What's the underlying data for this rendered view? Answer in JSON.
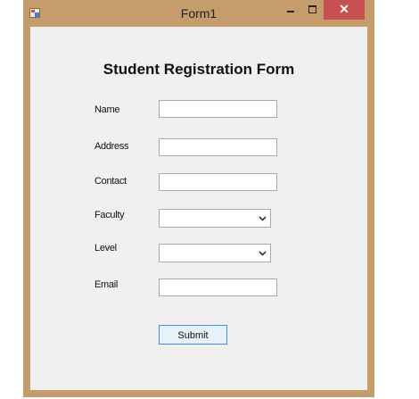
{
  "window": {
    "title": "Form1",
    "close_glyph": "✕",
    "icons": {
      "app": "form-app-icon",
      "minimize": "minimize-icon",
      "maximize": "maximize-icon",
      "close": "close-icon"
    },
    "colors": {
      "frame": "#c59c6c",
      "close_button": "#c75050",
      "client": "#f0f0f0",
      "submit_border": "#4a90d9"
    }
  },
  "form": {
    "heading": "Student Registration Form",
    "fields": {
      "name": {
        "label": "Name",
        "value": ""
      },
      "address": {
        "label": "Address",
        "value": ""
      },
      "contact": {
        "label": "Contact",
        "value": ""
      },
      "faculty": {
        "label": "Faculty",
        "selected": ""
      },
      "level": {
        "label": "Level",
        "selected": ""
      },
      "email": {
        "label": "Email",
        "value": ""
      }
    },
    "submit_label": "Submit"
  }
}
